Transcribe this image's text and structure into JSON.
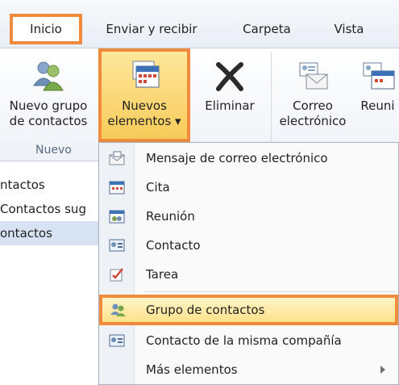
{
  "tabs": [
    {
      "label": "Inicio",
      "active": true
    },
    {
      "label": "Enviar y recibir",
      "active": false
    },
    {
      "label": "Carpeta",
      "active": false
    },
    {
      "label": "Vista",
      "active": false
    }
  ],
  "ribbon": {
    "new_contact_group": {
      "line1": "Nuevo grupo",
      "line2": "de contactos",
      "icon": "contact-group-icon"
    },
    "new_items": {
      "line1": "Nuevos",
      "line2": "elementos ▾",
      "icon": "calendar-items-icon"
    },
    "delete": {
      "label": "Eliminar",
      "icon": "delete-x-icon"
    },
    "email": {
      "line1": "Correo",
      "line2": "electrónico",
      "icon": "email-icon"
    },
    "meeting": {
      "label": "Reuni",
      "icon": "meeting-icon"
    },
    "group_label": "Nuevo"
  },
  "nav": {
    "items": [
      {
        "label": "ntactos"
      },
      {
        "label": "Contactos sug"
      },
      {
        "label": "ontactos"
      }
    ]
  },
  "menu": {
    "items": [
      {
        "label": "Mensaje de correo electrónico",
        "icon": "mail-message-icon"
      },
      {
        "label": "Cita",
        "icon": "appointment-icon"
      },
      {
        "label": "Reunión",
        "icon": "meeting-request-icon"
      },
      {
        "label": "Contacto",
        "icon": "contact-card-icon"
      },
      {
        "label": "Tarea",
        "icon": "task-icon"
      },
      {
        "label": "Grupo de contactos",
        "icon": "contact-group-icon"
      },
      {
        "label": "Contacto de la misma compañía",
        "icon": "contact-card-icon"
      },
      {
        "label": "Más elementos",
        "icon": ""
      }
    ]
  },
  "colors": {
    "highlight_border": "#f08a3c",
    "highlight_fill": "#fde28a",
    "selected_nav": "#d7e3f2"
  }
}
